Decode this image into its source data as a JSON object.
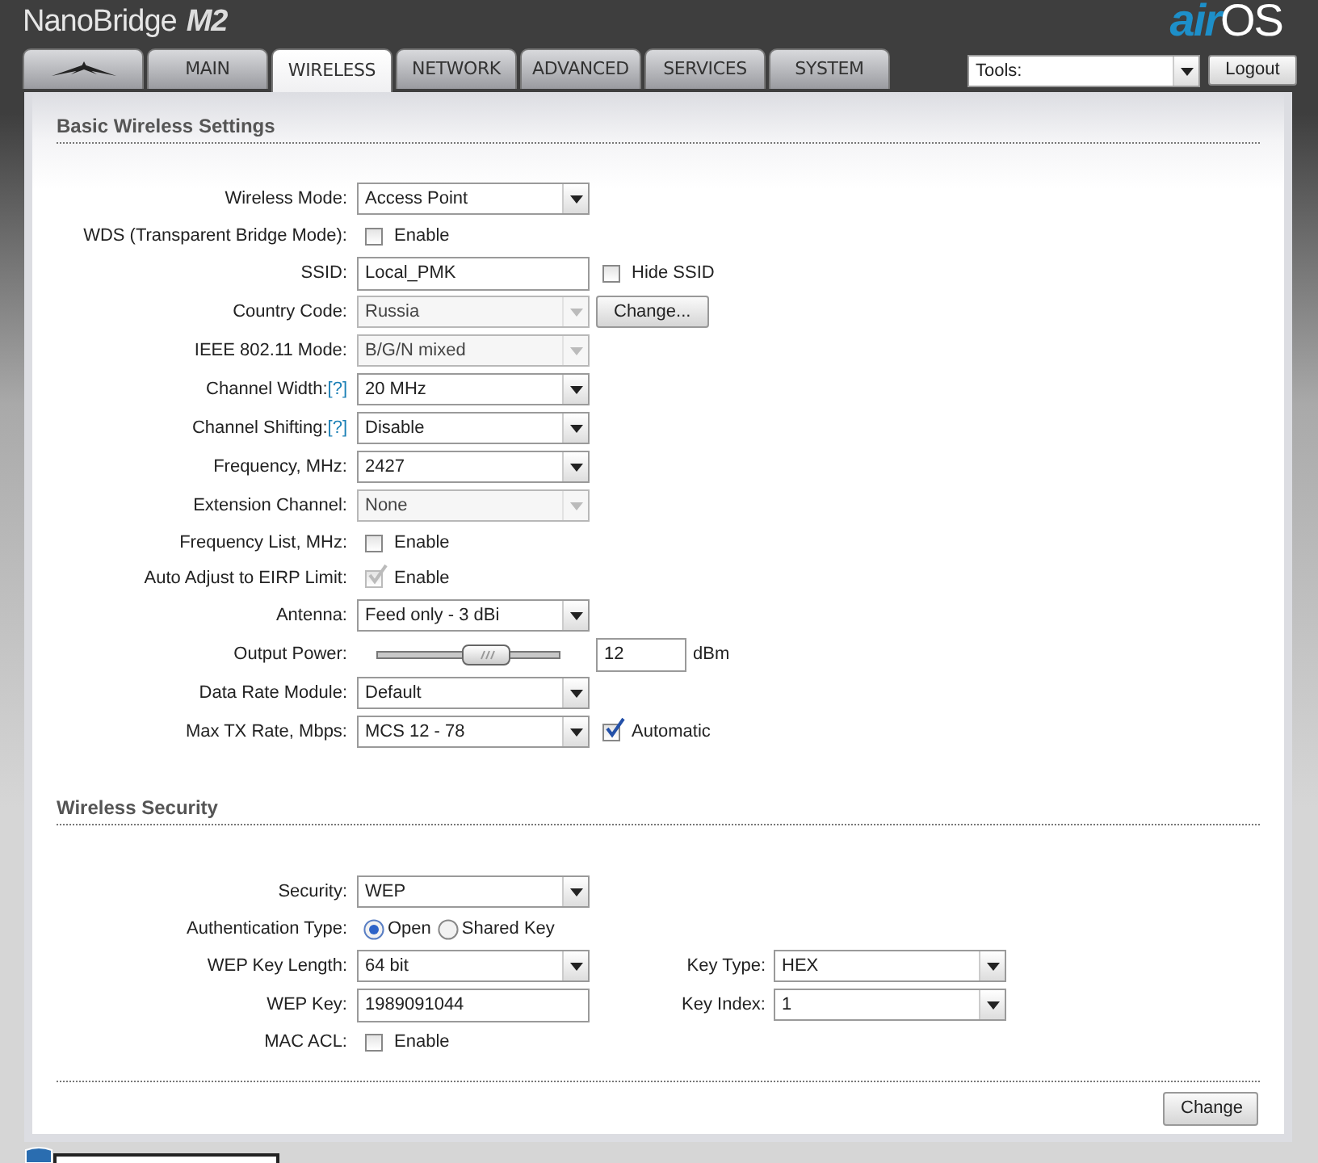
{
  "header": {
    "product": "NanoBridge",
    "model": "M2",
    "brand_prefix": "air",
    "brand_suffix": "OS"
  },
  "tabs": [
    {
      "kind": "logo",
      "selected": false
    },
    {
      "kind": "text",
      "label": "MAIN",
      "selected": false
    },
    {
      "kind": "text",
      "label": "WIRELESS",
      "selected": true
    },
    {
      "kind": "text",
      "label": "NETWORK",
      "selected": false
    },
    {
      "kind": "text",
      "label": "ADVANCED",
      "selected": false
    },
    {
      "kind": "text",
      "label": "SERVICES",
      "selected": false
    },
    {
      "kind": "text",
      "label": "SYSTEM",
      "selected": false
    }
  ],
  "tools": {
    "value": "Tools:"
  },
  "logout": "Logout",
  "sections": [
    {
      "title": "Basic Wireless Settings",
      "fields": [
        {
          "kind": "select",
          "label": "Wireless Mode:",
          "value": "Access Point",
          "disabled": false
        },
        {
          "kind": "checkbox",
          "label": "WDS (Transparent Bridge Mode):",
          "text": "Enable",
          "checked": false,
          "disabled": false
        },
        {
          "kind": "text",
          "label": "SSID:",
          "value": "Local_PMK",
          "extra": {
            "kind": "checkbox",
            "text": "Hide SSID",
            "checked": false,
            "disabled": false
          }
        },
        {
          "kind": "select",
          "label": "Country Code:",
          "value": "Russia",
          "disabled": true,
          "extra": {
            "kind": "button",
            "text": "Change..."
          }
        },
        {
          "kind": "select",
          "label": "IEEE 802.11 Mode:",
          "value": "B/G/N mixed",
          "disabled": true
        },
        {
          "kind": "select",
          "label": "Channel Width:",
          "help": "[?]",
          "value": "20 MHz",
          "disabled": false
        },
        {
          "kind": "select",
          "label": "Channel Shifting:",
          "help": "[?]",
          "value": "Disable",
          "disabled": false
        },
        {
          "kind": "select",
          "label": "Frequency, MHz:",
          "value": "2427",
          "disabled": false
        },
        {
          "kind": "select",
          "label": "Extension Channel:",
          "value": "None",
          "disabled": true
        },
        {
          "kind": "checkbox",
          "label": "Frequency List, MHz:",
          "text": "Enable",
          "checked": false,
          "disabled": false
        },
        {
          "kind": "checkbox",
          "label": "Auto Adjust to EIRP Limit:",
          "text": "Enable",
          "checked": true,
          "disabled": true
        },
        {
          "kind": "select",
          "label": "Antenna:",
          "value": "Feed only - 3 dBi",
          "disabled": false
        },
        {
          "kind": "slider",
          "label": "Output Power:",
          "level": 0.62,
          "value": "12",
          "unit": "dBm"
        },
        {
          "kind": "select",
          "label": "Data Rate Module:",
          "value": "Default",
          "disabled": false
        },
        {
          "kind": "select",
          "label": "Max TX Rate, Mbps:",
          "value": "MCS 12 - 78",
          "disabled": false,
          "extra": {
            "kind": "checkbox",
            "text": "Automatic",
            "checked": true,
            "disabled": false
          }
        }
      ]
    },
    {
      "title": "Wireless Security",
      "fields": [
        {
          "kind": "select",
          "label": "Security:",
          "value": "WEP",
          "disabled": false
        },
        {
          "kind": "radio",
          "label": "Authentication Type:",
          "options": [
            {
              "text": "Open",
              "selected": true
            },
            {
              "text": "Shared Key",
              "selected": false
            }
          ]
        },
        {
          "kind": "select",
          "label": "WEP Key Length:",
          "value": "64 bit",
          "disabled": false,
          "side": {
            "kind": "select",
            "label": "Key Type:",
            "value": "HEX",
            "disabled": false
          }
        },
        {
          "kind": "text",
          "label": "WEP Key:",
          "value": "1989091044",
          "side": {
            "kind": "select",
            "label": "Key Index:",
            "value": "1",
            "disabled": false
          }
        },
        {
          "kind": "checkbox",
          "label": "MAC ACL:",
          "text": "Enable",
          "checked": false,
          "disabled": false
        }
      ]
    }
  ],
  "submit": "Change"
}
